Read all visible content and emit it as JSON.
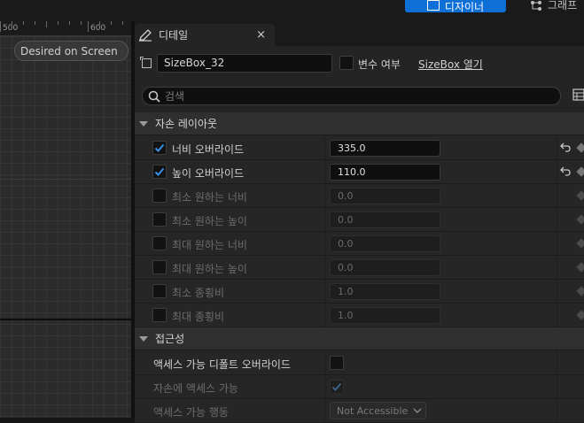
{
  "toolbar": {
    "designer_label": "디자이너",
    "graph_label": "그래프"
  },
  "viewport": {
    "ruler_labels": [
      "500",
      "600"
    ],
    "desired_dropdown": "Desired on Screen"
  },
  "details": {
    "tab_title": "디테일",
    "close_symbol": "×",
    "widget_name": "SizeBox_32",
    "is_variable_label": "변수 여부",
    "open_link": "SizeBox 열기",
    "search_placeholder": "검색"
  },
  "sections": {
    "child_layout": {
      "title": "자손 레이아웃",
      "rows": [
        {
          "label": "너비 오버라이드",
          "value": "335.0",
          "checked": true,
          "enabled": true
        },
        {
          "label": "높이 오버라이드",
          "value": "110.0",
          "checked": true,
          "enabled": true
        },
        {
          "label": "최소 원하는 너비",
          "value": "0.0",
          "checked": false,
          "enabled": false
        },
        {
          "label": "최소 원하는 높이",
          "value": "0.0",
          "checked": false,
          "enabled": false
        },
        {
          "label": "최대 원하는 너비",
          "value": "0.0",
          "checked": false,
          "enabled": false
        },
        {
          "label": "최대 원하는 높이",
          "value": "0.0",
          "checked": false,
          "enabled": false
        },
        {
          "label": "최소 종횡비",
          "value": "1.0",
          "checked": false,
          "enabled": false
        },
        {
          "label": "최대 종횡비",
          "value": "1.0",
          "checked": false,
          "enabled": false
        }
      ]
    },
    "accessibility": {
      "title": "접근성",
      "override_label": "액세스 가능 디폴트 오버라이드",
      "children_label": "자손에 액세스 가능",
      "behavior_label": "액세스 가능 행동",
      "behavior_value": "Not Accessible"
    }
  },
  "colors": {
    "accent": "#0e6fd6",
    "check": "#3a8ee6"
  }
}
